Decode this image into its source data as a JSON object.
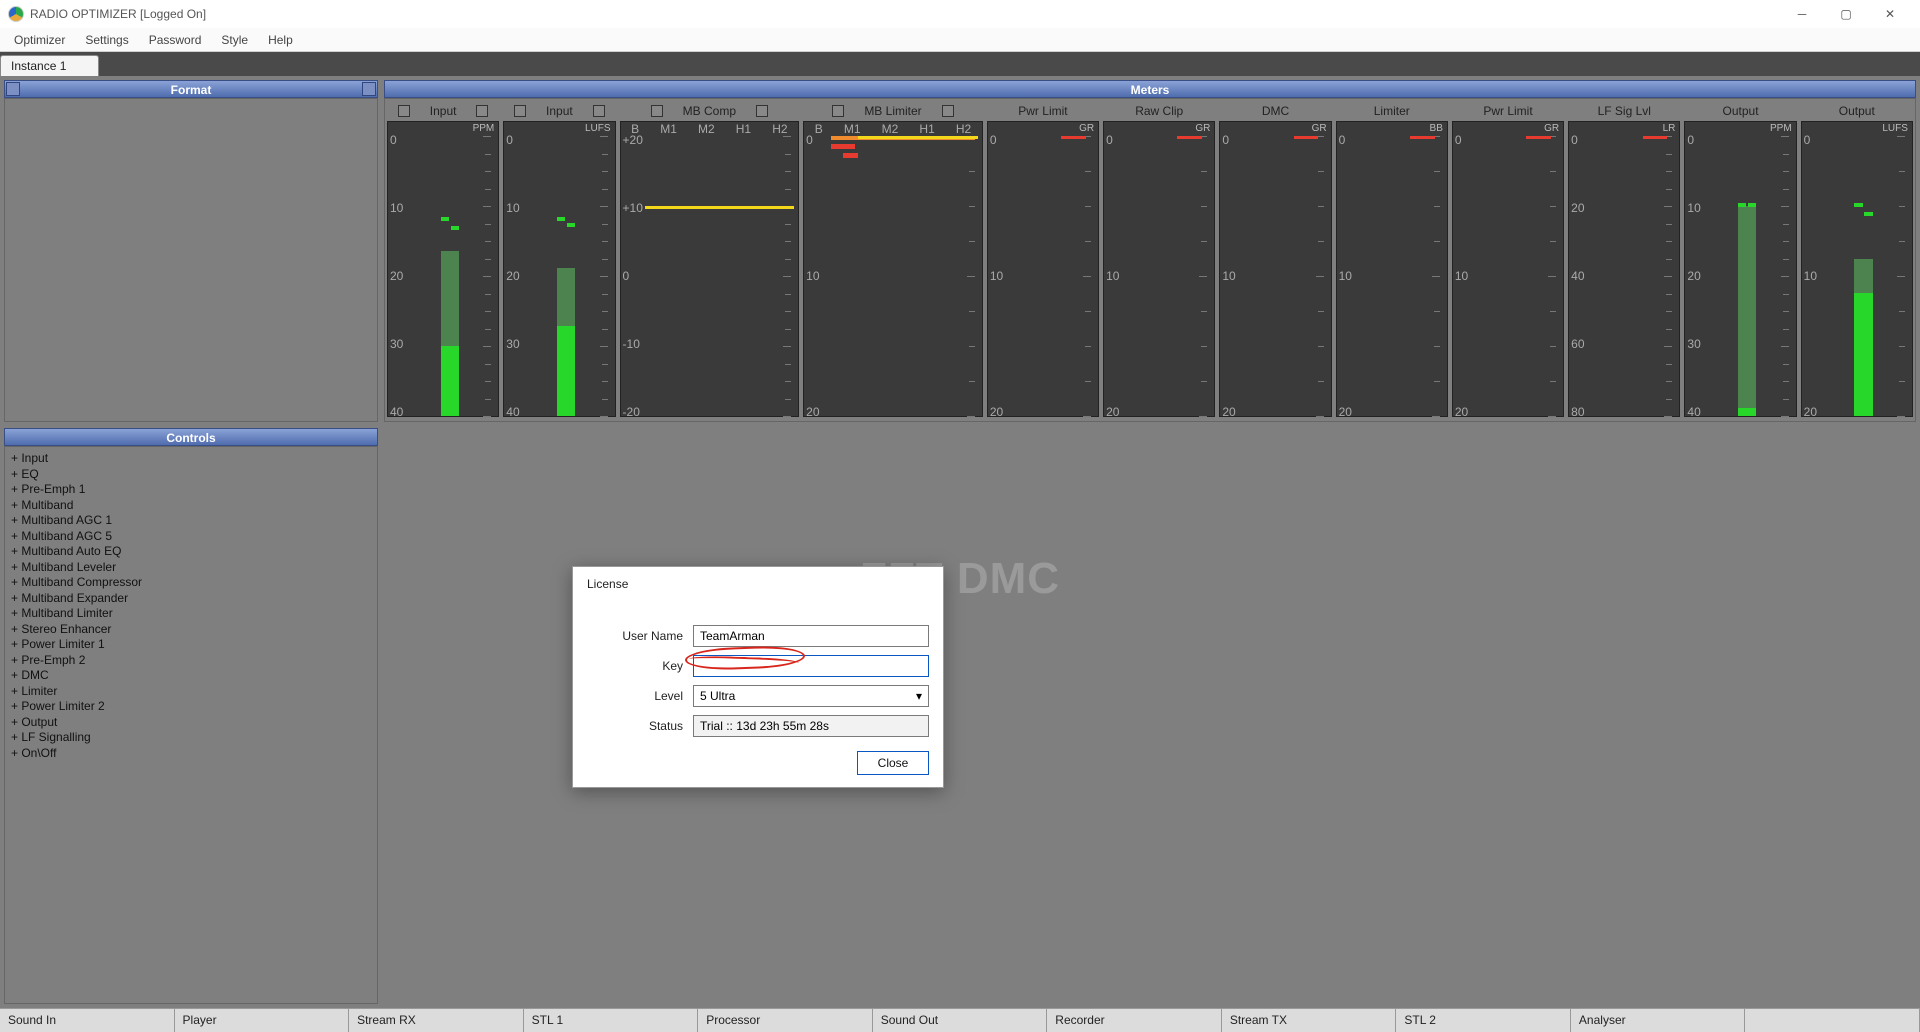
{
  "window": {
    "title": "RADIO OPTIMIZER [Logged On]"
  },
  "menu": {
    "items": [
      "Optimizer",
      "Settings",
      "Password",
      "Style",
      "Help"
    ]
  },
  "tab": {
    "label": "Instance 1"
  },
  "panels": {
    "format": "Format",
    "meters": "Meters",
    "controls": "Controls"
  },
  "fft_text": "FFT DMC",
  "controls_list": [
    "+ Input",
    "+ EQ",
    "+ Pre-Emph 1",
    "+ Multiband",
    "+ Multiband AGC 1",
    "+ Multiband AGC 5",
    "+ Multiband Auto EQ",
    "+ Multiband Leveler",
    "+ Multiband Compressor",
    "+ Multiband Expander",
    "+ Multiband Limiter",
    "+ Stereo Enhancer",
    "+ Power Limiter 1",
    "+ Pre-Emph 2",
    "+ DMC",
    "+ Limiter",
    "+ Power Limiter 2",
    "+ Output",
    "+ LF Signalling",
    "+ On\\Off"
  ],
  "bottom_tabs": [
    "Sound In",
    "Player",
    "Stream RX",
    "STL 1",
    "Processor",
    "Sound Out",
    "Recorder",
    "Stream TX",
    "STL 2",
    "Analyser",
    ""
  ],
  "meters": {
    "cols": [
      {
        "title": "Input",
        "head": "PPM",
        "scale": [
          "0",
          "10",
          "20",
          "30",
          "40"
        ]
      },
      {
        "title": "Input",
        "head": "LUFS",
        "scale": [
          "0",
          "10",
          "20",
          "30",
          "40"
        ]
      },
      {
        "title": "MB Comp",
        "bands": [
          "B",
          "M1",
          "M2",
          "H1",
          "H2"
        ],
        "scale": [
          "+20",
          "+10",
          "0",
          "-10",
          "-20"
        ]
      },
      {
        "title": "MB Limiter",
        "bands": [
          "B",
          "M1",
          "M2",
          "H1",
          "H2"
        ],
        "scale": [
          "0",
          "10",
          "20"
        ]
      },
      {
        "title": "Pwr Limit",
        "head": "GR",
        "scale": [
          "0",
          "10",
          "20"
        ]
      },
      {
        "title": "Raw Clip",
        "head": "GR",
        "scale": [
          "0",
          "10",
          "20"
        ]
      },
      {
        "title": "DMC",
        "head": "GR",
        "scale": [
          "0",
          "10",
          "20"
        ]
      },
      {
        "title": "Limiter",
        "head": "BB",
        "scale": [
          "0",
          "10",
          "20"
        ]
      },
      {
        "title": "Pwr Limit",
        "head": "GR",
        "scale": [
          "0",
          "10",
          "20"
        ]
      },
      {
        "title": "LF Sig Lvl",
        "head": "LR",
        "scale": [
          "0",
          "20",
          "40",
          "60",
          "80"
        ]
      },
      {
        "title": "Output",
        "head": "PPM",
        "scale": [
          "0",
          "10",
          "20",
          "30",
          "40"
        ]
      },
      {
        "title": "Output",
        "head": "LUFS",
        "scale": [
          "0",
          "10",
          "20"
        ]
      }
    ]
  },
  "dialog": {
    "title": "License",
    "labels": {
      "user": "User Name",
      "key": "Key",
      "level": "Level",
      "status": "Status"
    },
    "values": {
      "user": "TeamArman",
      "key": "",
      "level": "5 Ultra",
      "status": "Trial :: 13d 23h 55m 28s"
    },
    "close": "Close"
  }
}
